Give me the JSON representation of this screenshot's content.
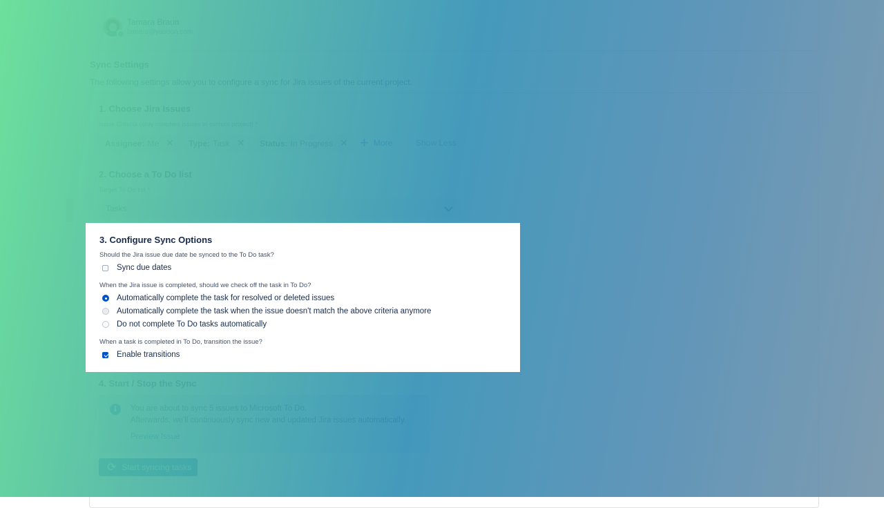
{
  "user": {
    "name": "Tamara Braun",
    "email": "tamara@yasoon.com"
  },
  "sync_settings": {
    "title": "Sync Settings",
    "description": "The following settings allow you to configure a sync for Jira issues of the current project."
  },
  "step1": {
    "title": "1. Choose Jira Issues",
    "label": "Issue Criteria (only matches issues in current project)",
    "required_mark": "*",
    "chips": [
      {
        "key": "Assignee:",
        "value": "Me"
      },
      {
        "key": "Type:",
        "value": "Task"
      },
      {
        "key": "Status:",
        "value": "In Progress"
      }
    ],
    "more_label": "More",
    "show_less_label": "Show Less"
  },
  "step2": {
    "title": "2. Choose a To Do list",
    "label": "Target To Do list",
    "required_mark": "*",
    "selected": "Tasks"
  },
  "step3": {
    "title": "3. Configure Sync Options",
    "q1": "Should the Jira issue due date be synced to the To Do task?",
    "due_dates_label": "Sync due dates",
    "due_dates_checked": false,
    "q2": "When the Jira issue is completed, should we check off the task in To Do?",
    "radio_options": [
      "Automatically complete the task for resolved or deleted issues",
      "Automatically complete the task when the issue doesn't match the above criteria anymore",
      "Do not complete To Do tasks automatically"
    ],
    "radio_selected": 0,
    "q3": "When a task is completed in To Do, transition the issue?",
    "transitions_label": "Enable transitions",
    "transitions_checked": true
  },
  "step4": {
    "title": "4. Start / Stop the Sync",
    "info_line1": "You are about to sync 5 issues to Microsoft To Do.",
    "info_line2": "Afterwards, we'll continuously sync new and updated Jira issues automatically.",
    "preview_link": "Preview Issue",
    "start_button": "Start syncing tasks"
  },
  "colors": {
    "accent": "#0052cc",
    "text": "#172b4d",
    "overlay_left": "#68df98",
    "overlay_right": "#7091a8"
  }
}
